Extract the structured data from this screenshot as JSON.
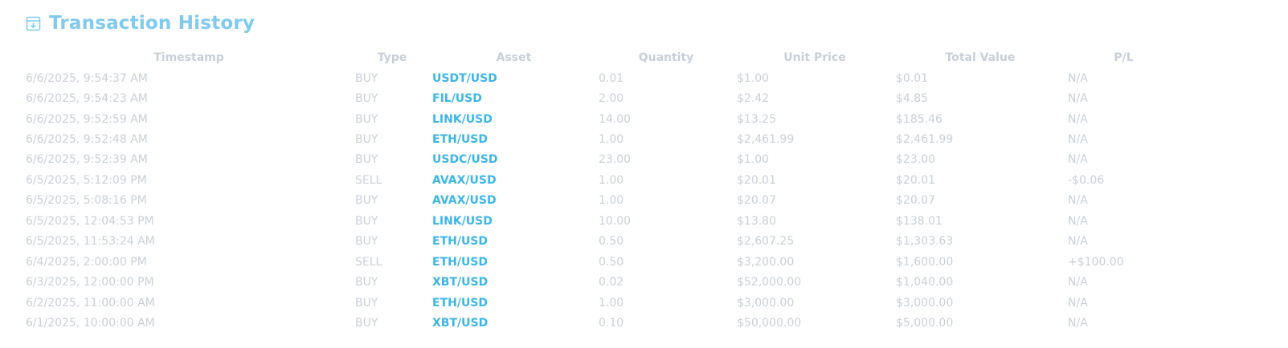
{
  "header": {
    "title": "Transaction History",
    "icon": "archive-download-icon"
  },
  "colors": {
    "title": "#7fcaed",
    "asset_link": "#3cb6e6",
    "muted_text": "#c9d0d7",
    "header_text": "#c7cfd8"
  },
  "table": {
    "columns": [
      "Timestamp",
      "Type",
      "Asset",
      "Quantity",
      "Unit Price",
      "Total Value",
      "P/L"
    ],
    "rows": [
      {
        "timestamp": "6/6/2025, 9:54:37 AM",
        "type": "BUY",
        "asset": "USDT/USD",
        "quantity": "0.01",
        "unit_price": "$1.00",
        "total_value": "$0.01",
        "pl": "N/A"
      },
      {
        "timestamp": "6/6/2025, 9:54:23 AM",
        "type": "BUY",
        "asset": "FIL/USD",
        "quantity": "2.00",
        "unit_price": "$2.42",
        "total_value": "$4.85",
        "pl": "N/A"
      },
      {
        "timestamp": "6/6/2025, 9:52:59 AM",
        "type": "BUY",
        "asset": "LINK/USD",
        "quantity": "14.00",
        "unit_price": "$13.25",
        "total_value": "$185.46",
        "pl": "N/A"
      },
      {
        "timestamp": "6/6/2025, 9:52:48 AM",
        "type": "BUY",
        "asset": "ETH/USD",
        "quantity": "1.00",
        "unit_price": "$2,461.99",
        "total_value": "$2,461.99",
        "pl": "N/A"
      },
      {
        "timestamp": "6/6/2025, 9:52:39 AM",
        "type": "BUY",
        "asset": "USDC/USD",
        "quantity": "23.00",
        "unit_price": "$1.00",
        "total_value": "$23.00",
        "pl": "N/A"
      },
      {
        "timestamp": "6/5/2025, 5:12:09 PM",
        "type": "SELL",
        "asset": "AVAX/USD",
        "quantity": "1.00",
        "unit_price": "$20.01",
        "total_value": "$20.01",
        "pl": "-$0.06"
      },
      {
        "timestamp": "6/5/2025, 5:08:16 PM",
        "type": "BUY",
        "asset": "AVAX/USD",
        "quantity": "1.00",
        "unit_price": "$20.07",
        "total_value": "$20.07",
        "pl": "N/A"
      },
      {
        "timestamp": "6/5/2025, 12:04:53 PM",
        "type": "BUY",
        "asset": "LINK/USD",
        "quantity": "10.00",
        "unit_price": "$13.80",
        "total_value": "$138.01",
        "pl": "N/A"
      },
      {
        "timestamp": "6/5/2025, 11:53:24 AM",
        "type": "BUY",
        "asset": "ETH/USD",
        "quantity": "0.50",
        "unit_price": "$2,607.25",
        "total_value": "$1,303.63",
        "pl": "N/A"
      },
      {
        "timestamp": "6/4/2025, 2:00:00 PM",
        "type": "SELL",
        "asset": "ETH/USD",
        "quantity": "0.50",
        "unit_price": "$3,200.00",
        "total_value": "$1,600.00",
        "pl": "+$100.00"
      },
      {
        "timestamp": "6/3/2025, 12:00:00 PM",
        "type": "BUY",
        "asset": "XBT/USD",
        "quantity": "0.02",
        "unit_price": "$52,000.00",
        "total_value": "$1,040.00",
        "pl": "N/A"
      },
      {
        "timestamp": "6/2/2025, 11:00:00 AM",
        "type": "BUY",
        "asset": "ETH/USD",
        "quantity": "1.00",
        "unit_price": "$3,000.00",
        "total_value": "$3,000.00",
        "pl": "N/A"
      },
      {
        "timestamp": "6/1/2025, 10:00:00 AM",
        "type": "BUY",
        "asset": "XBT/USD",
        "quantity": "0.10",
        "unit_price": "$50,000.00",
        "total_value": "$5,000.00",
        "pl": "N/A"
      }
    ]
  }
}
